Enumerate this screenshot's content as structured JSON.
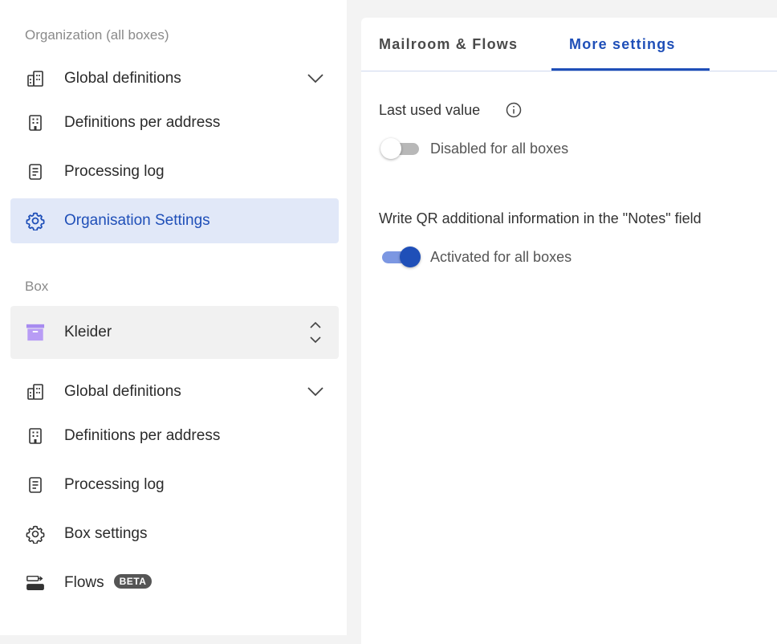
{
  "sidebar": {
    "org_section_label": "Organization (all boxes)",
    "org_items": [
      {
        "label": "Global definitions",
        "icon": "building-grid-icon",
        "has_chevron": true
      },
      {
        "label": "Definitions per address",
        "icon": "building-icon"
      },
      {
        "label": "Processing log",
        "icon": "document-icon"
      },
      {
        "label": "Organisation Settings",
        "icon": "gear-icon",
        "active": true
      }
    ],
    "box_section_label": "Box",
    "box_selector": {
      "label": "Kleider",
      "icon": "archive-box-icon",
      "icon_color": "#a78bf0"
    },
    "box_items": [
      {
        "label": "Global definitions",
        "icon": "building-grid-icon",
        "has_chevron": true
      },
      {
        "label": "Definitions per address",
        "icon": "building-icon"
      },
      {
        "label": "Processing log",
        "icon": "document-icon"
      },
      {
        "label": "Box settings",
        "icon": "gear-icon"
      },
      {
        "label": "Flows",
        "icon": "flows-icon",
        "badge": "BETA"
      }
    ]
  },
  "main": {
    "tabs": [
      {
        "label": "Mailroom & Flows",
        "active": false
      },
      {
        "label": "More settings",
        "active": true
      }
    ],
    "settings": [
      {
        "label": "Last used value",
        "has_info": true,
        "toggle_on": false,
        "toggle_text": "Disabled for all boxes"
      },
      {
        "label": "Write QR additional information in the \"Notes\" field",
        "toggle_on": true,
        "toggle_text": "Activated for all boxes"
      }
    ]
  },
  "colors": {
    "accent": "#1f4fb8",
    "active_bg": "#e1e8f8",
    "toggle_on_track": "#7c97e2"
  }
}
